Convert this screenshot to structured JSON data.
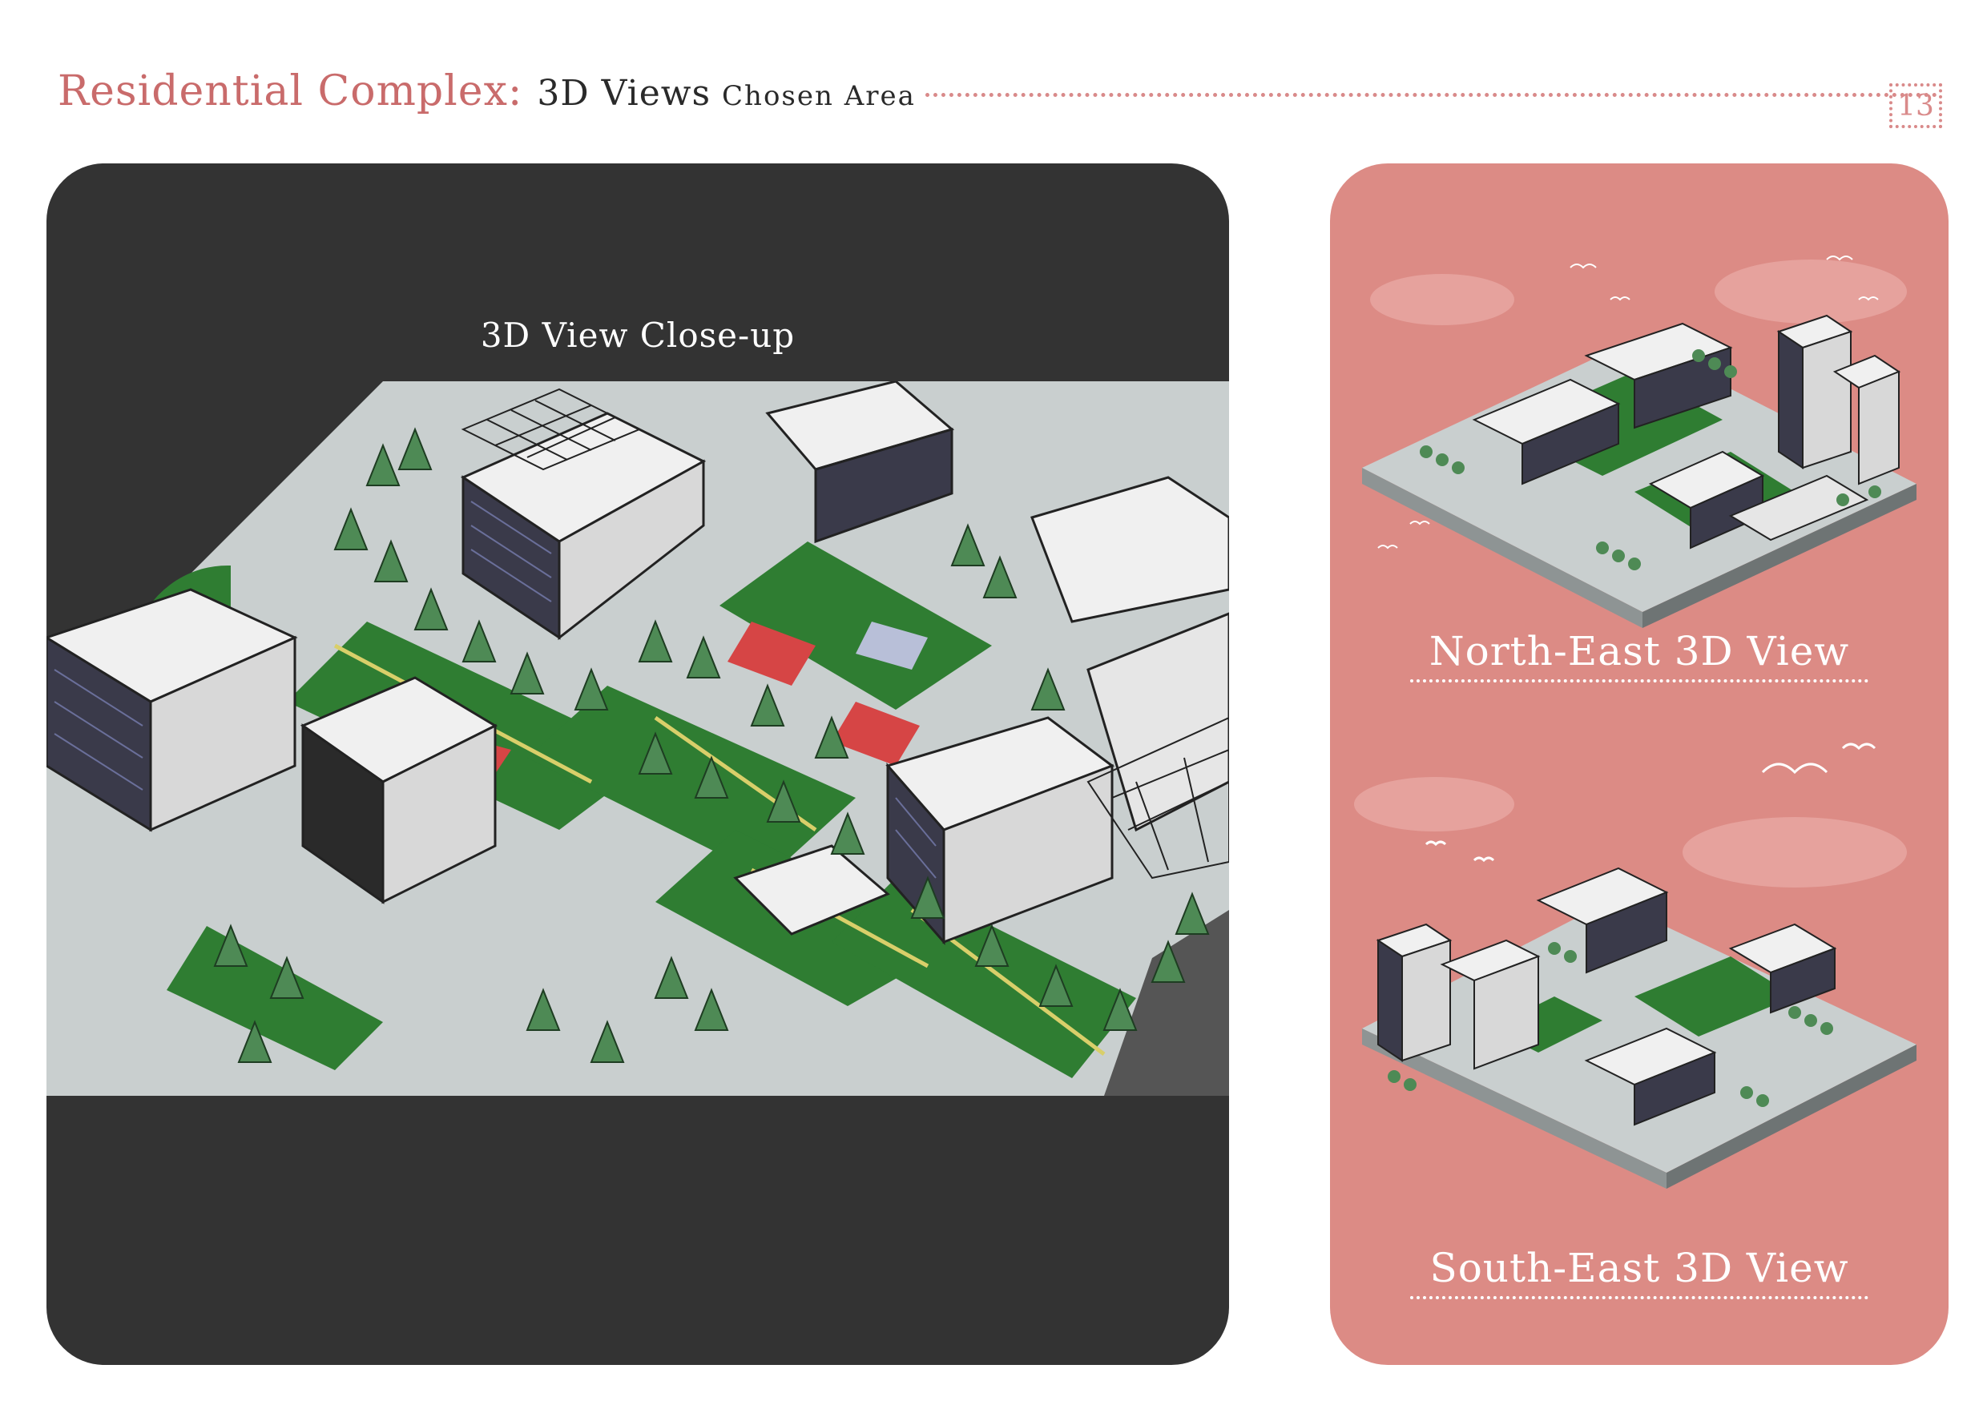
{
  "header": {
    "title": "Residential Complex:",
    "subtitle": "3D Views",
    "detail": "Chosen Area",
    "page_number": "13"
  },
  "closeup": {
    "title": "3D View Close-up"
  },
  "views": [
    {
      "label": "North-East 3D View"
    },
    {
      "label": "South-East 3D View"
    }
  ],
  "colors": {
    "accent": "#c96b6b",
    "panel_dark": "#333333",
    "panel_pink": "#dc8b85",
    "grass": "#2f7d32",
    "tree": "#4e8a55",
    "building": "#f0f0f0",
    "road": "#c9cfcf",
    "court": "#d64545"
  }
}
